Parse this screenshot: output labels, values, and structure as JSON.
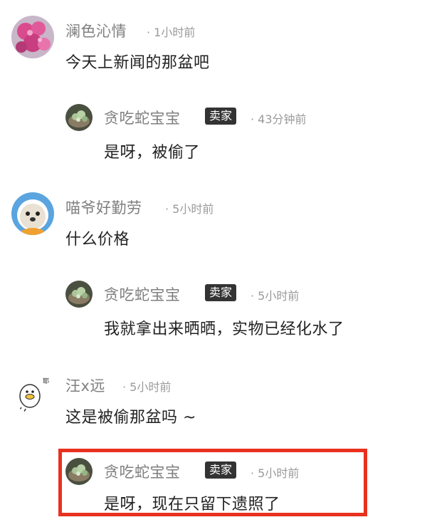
{
  "comments": [
    {
      "username": "澜色沁情",
      "time": "· 1小时前",
      "text": "今天上新闻的那盆吧"
    },
    {
      "username": "贪吃蛇宝宝",
      "badge": "卖家",
      "time": "· 43分钟前",
      "text": "是呀，被偷了"
    },
    {
      "username": "喵爷好勤劳",
      "time": "· 5小时前",
      "text": "什么价格"
    },
    {
      "username": "贪吃蛇宝宝",
      "badge": "卖家",
      "time": "· 5小时前",
      "text": "我就拿出来晒晒，实物已经化水了"
    },
    {
      "username": "汪x远",
      "time": "· 5小时前",
      "text": "这是被偷那盆吗 ~"
    },
    {
      "username": "贪吃蛇宝宝",
      "badge": "卖家",
      "time": "· 5小时前",
      "text": "是呀，现在只留下遗照了"
    }
  ],
  "colors": {
    "highlight": "#e8311f",
    "badge_bg": "#333333",
    "username": "#7f7f7f",
    "meta": "#9a9a9a"
  }
}
